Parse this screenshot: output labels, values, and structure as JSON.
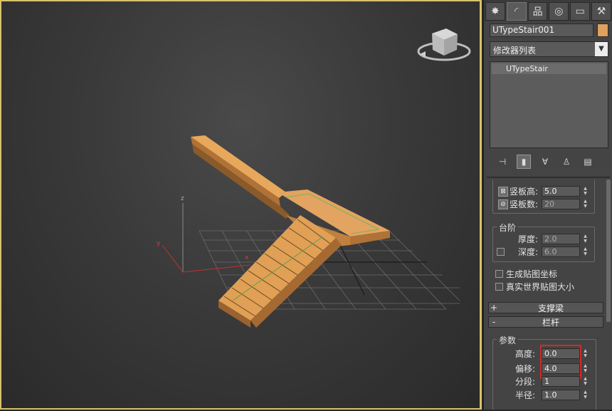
{
  "viewport": {
    "axis_labels": {
      "z": "z",
      "y": "y",
      "x": "x"
    }
  },
  "panel": {
    "tabs": [
      {
        "name": "create-tab",
        "glyph": "✸"
      },
      {
        "name": "modify-tab",
        "glyph": "◜"
      },
      {
        "name": "hierarchy-tab",
        "glyph": "品"
      },
      {
        "name": "motion-tab",
        "glyph": "◎"
      },
      {
        "name": "display-tab",
        "glyph": "▭"
      },
      {
        "name": "utilities-tab",
        "glyph": "⚒"
      }
    ],
    "object_name": "UTypeStair001",
    "object_color": "#e0a060",
    "modifier_list_label": "修改器列表",
    "stack_item": "UTypeStair",
    "riser": {
      "height_label": "竖板高:",
      "height_value": "5.0",
      "count_label": "竖板数:",
      "count_value": "20"
    },
    "steps": {
      "title": "台阶",
      "thickness_label": "厚度:",
      "thickness_value": "2.0",
      "depth_label": "深度:",
      "depth_value": "6.0"
    },
    "gen_map_coords_label": "生成贴图坐标",
    "real_world_map_label": "真实世界贴图大小",
    "stringers_rollout": {
      "sign": "+",
      "title": "支撑梁"
    },
    "railings_rollout": {
      "sign": "-",
      "title": "栏杆"
    },
    "params": {
      "title": "参数",
      "height_label": "高度:",
      "height_value": "0.0",
      "offset_label": "偏移:",
      "offset_value": "4.0",
      "segments_label": "分段:",
      "segments_value": "1",
      "radius_label": "半径:",
      "radius_value": "1.0"
    }
  }
}
